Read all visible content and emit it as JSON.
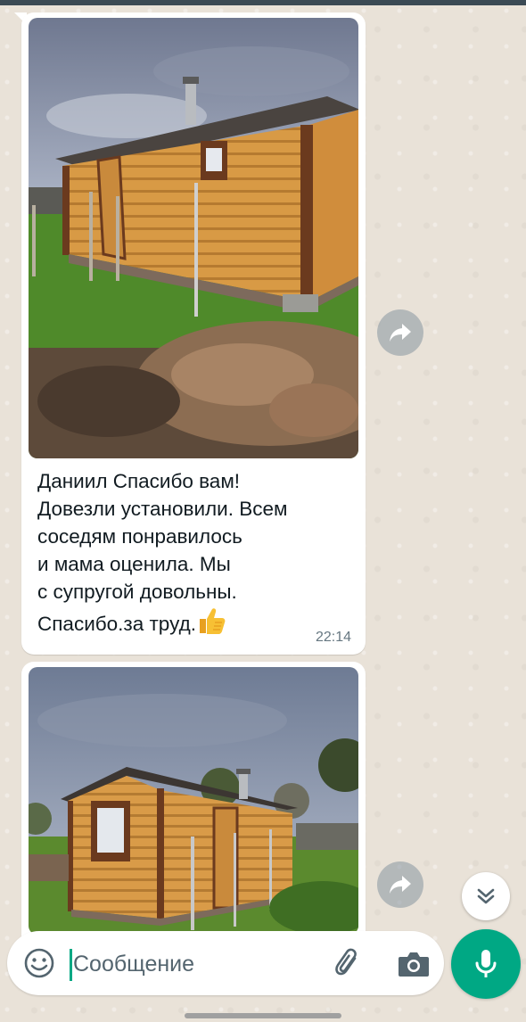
{
  "messages": [
    {
      "photo_alt": "",
      "text": "Даниил Спасибо вам!\nДовезли установили. Всем\nсоседям понравилось\nи  мама оценила. Мы\nс супругой довольны.\nСпасибо.за труд.",
      "emoji": "thumbs-up",
      "time": "22:14"
    },
    {
      "photo_alt": ""
    }
  ],
  "composer": {
    "placeholder": "Сообщение",
    "emoji_icon": "emoji-icon",
    "attach_icon": "paperclip-icon",
    "camera_icon": "camera-icon",
    "mic_icon": "microphone-icon"
  },
  "controls": {
    "forward_icon": "forward-icon",
    "scroll_down_icon": "double-chevron-down-icon"
  },
  "colors": {
    "accent": "#00a884",
    "bubble": "#ffffff",
    "wallpaper": "#e9e2d8"
  }
}
